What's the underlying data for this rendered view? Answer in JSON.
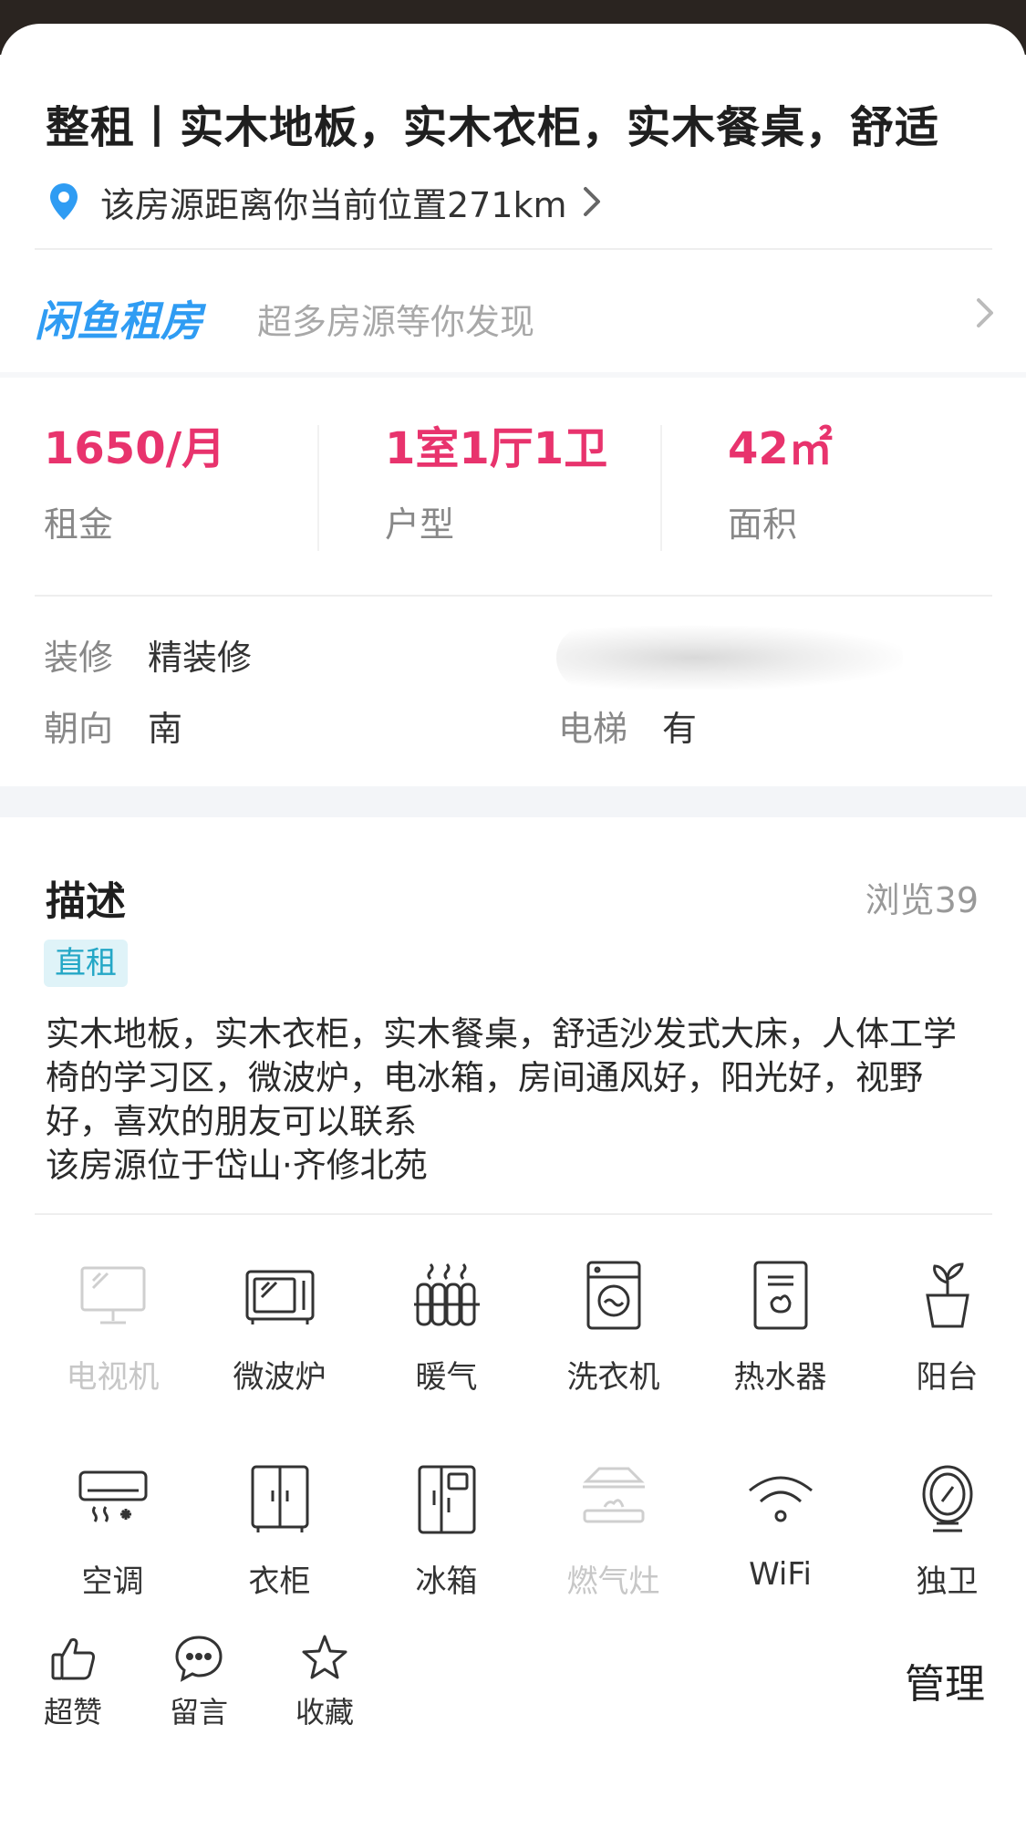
{
  "listing": {
    "title": "整租丨实木地板，实木衣柜，实木餐桌，舒适",
    "location_text": "该房源距离你当前位置271km"
  },
  "banner": {
    "brand": "闲鱼租房",
    "slogan": "超多房源等你发现"
  },
  "stats": [
    {
      "value": "1650/月",
      "label": "租金"
    },
    {
      "value": "1室1厅1卫",
      "label": "户型"
    },
    {
      "value": "42㎡",
      "label": "面积"
    }
  ],
  "attributes": {
    "decoration": {
      "key": "装修",
      "value": "精装修"
    },
    "orientation": {
      "key": "朝向",
      "value": "南"
    },
    "elevator": {
      "key": "电梯",
      "value": "有"
    }
  },
  "description": {
    "title": "描述",
    "views": "浏览39",
    "tag": "直租",
    "body": "实木地板，实木衣柜，实木餐桌，舒适沙发式大床，人体工学椅的学习区，微波炉，电冰箱，房间通风好，阳光好，视野好，喜欢的朋友可以联系\n该房源位于岱山·齐修北苑"
  },
  "amenities": [
    {
      "label": "电视机",
      "icon": "tv-icon",
      "available": false
    },
    {
      "label": "微波炉",
      "icon": "microwave-icon",
      "available": true
    },
    {
      "label": "暖气",
      "icon": "radiator-icon",
      "available": true
    },
    {
      "label": "洗衣机",
      "icon": "washing-machine-icon",
      "available": true
    },
    {
      "label": "热水器",
      "icon": "water-heater-icon",
      "available": true
    },
    {
      "label": "阳台",
      "icon": "balcony-plant-icon",
      "available": true
    },
    {
      "label": "空调",
      "icon": "air-conditioner-icon",
      "available": true
    },
    {
      "label": "衣柜",
      "icon": "wardrobe-icon",
      "available": true
    },
    {
      "label": "冰箱",
      "icon": "fridge-icon",
      "available": true
    },
    {
      "label": "燃气灶",
      "icon": "gas-stove-icon",
      "available": false
    },
    {
      "label": "WiFi",
      "icon": "wifi-icon",
      "available": true
    },
    {
      "label": "独卫",
      "icon": "mirror-icon",
      "available": true
    }
  ],
  "bottom_bar": {
    "like": "超赞",
    "comment": "留言",
    "favorite": "收藏",
    "manage": "管理"
  },
  "colors": {
    "accent_price": "#e8336d",
    "brand_blue": "#2f9cf3",
    "tag_bg": "#dff3f8",
    "tag_text": "#24a7c6"
  }
}
